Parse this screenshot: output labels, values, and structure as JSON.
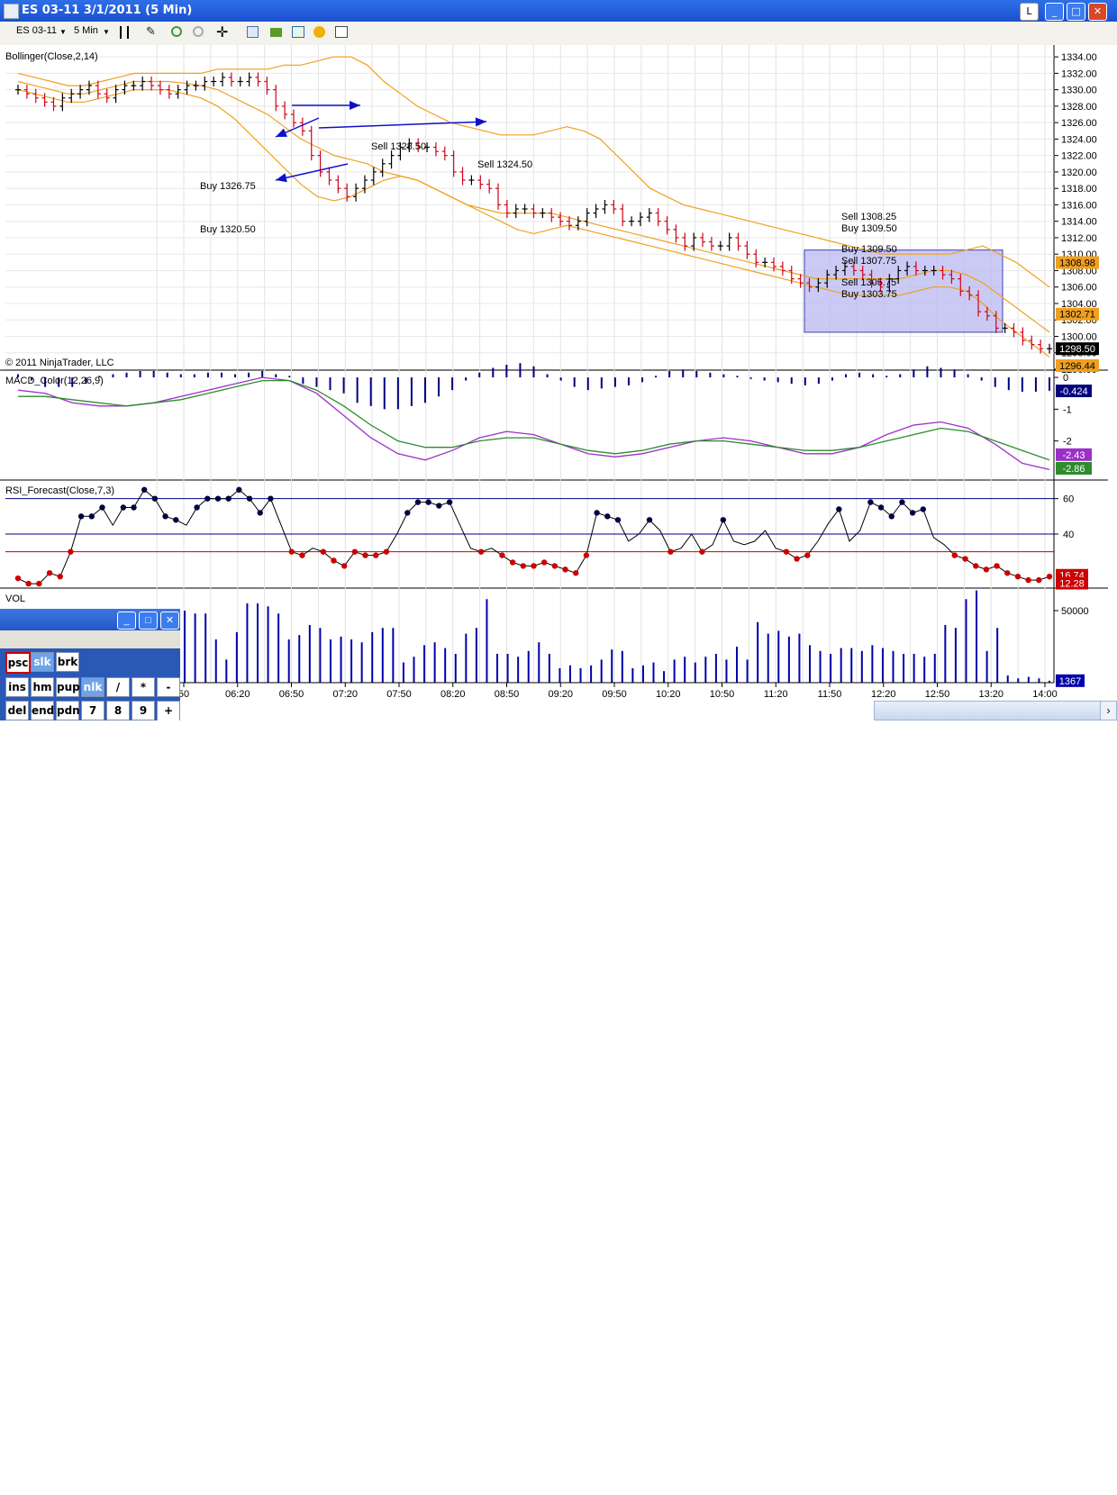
{
  "window": {
    "title": "ES 03-11  3/1/2011 (5 Min)",
    "buttons": {
      "lock": "L",
      "minimize": "_",
      "maximize": "□",
      "close": "✕"
    }
  },
  "toolbar": {
    "instrument": "ES 03-11",
    "interval": "5 Min",
    "icons": [
      "bar-style-icon",
      "drawing-tool-icon",
      "zoom-in-icon",
      "zoom-out-icon",
      "crosshair-icon",
      "data-box-icon",
      "instrument-icon",
      "strategy-icon",
      "order-icon",
      "properties-icon"
    ]
  },
  "colors": {
    "up_bar": "#000000",
    "down_bar": "#d0021b",
    "neutral_bar": "#2ea02e",
    "bollinger": "#f0a020",
    "macd_hist": "#000080",
    "macd_line": "#9b30c8",
    "macd_signal": "#2e8b2e",
    "rsi_line": "#000000",
    "rsi_high_dot": "#000040",
    "rsi_low_dot": "#cc0000",
    "volume": "#0000aa",
    "highlight_box": "#b8b8f0"
  },
  "chart_data": [
    {
      "type": "line",
      "title": "Bollinger(Close,2,14)",
      "copyright": "© 2011 NinjaTrader, LLC",
      "ylim": [
        1296,
        1335
      ],
      "y_ticks": [
        1334,
        1332,
        1330,
        1328,
        1326,
        1324,
        1322,
        1320,
        1318,
        1316,
        1314,
        1312,
        1310,
        1308,
        1306,
        1304,
        1302,
        1300,
        1298,
        1296
      ],
      "y_tick_labels": [
        "1334.00",
        "1332.00",
        "1330.00",
        "1328.00",
        "1326.00",
        "1324.00",
        "1322.00",
        "1320.00",
        "1318.00",
        "1316.00",
        "1314.00",
        "1312.00",
        "1310.00",
        "1308.00",
        "1306.00",
        "1304.00",
        "1302.00",
        "1300.00",
        "1298.00",
        "1296.00"
      ],
      "price_closes": [
        1330,
        1329.5,
        1329,
        1328.5,
        1328,
        1329,
        1329.5,
        1330,
        1330.5,
        1329.5,
        1329,
        1330,
        1330.5,
        1330.5,
        1331,
        1330.5,
        1330,
        1329.5,
        1330,
        1330.5,
        1330.5,
        1331,
        1331,
        1331.5,
        1331,
        1331,
        1331.5,
        1331,
        1330,
        1328,
        1327,
        1326,
        1325,
        1322,
        1320,
        1319,
        1318,
        1317,
        1318,
        1319,
        1320,
        1321,
        1322,
        1323,
        1323.5,
        1323,
        1323,
        1322.5,
        1322,
        1320,
        1319,
        1319,
        1318.5,
        1318,
        1316,
        1315,
        1315.5,
        1315.5,
        1315,
        1315,
        1314.5,
        1314,
        1313.5,
        1314,
        1315,
        1315.5,
        1316,
        1315.5,
        1314,
        1314,
        1314.5,
        1315,
        1314,
        1313,
        1312,
        1311,
        1312,
        1311.5,
        1311,
        1311,
        1312,
        1311,
        1310,
        1309,
        1309,
        1308.5,
        1308,
        1307,
        1306.5,
        1306,
        1306.5,
        1307.5,
        1308,
        1308.5,
        1308,
        1307.5,
        1306.5,
        1306,
        1307,
        1308,
        1308.5,
        1308,
        1308,
        1308,
        1307.5,
        1307,
        1305.5,
        1305,
        1303,
        1302.5,
        1301,
        1301,
        1300.5,
        1299.5,
        1299,
        1298.5,
        1298.5
      ],
      "bollinger_upper": [
        1332,
        1331.5,
        1331,
        1330.5,
        1330.5,
        1331,
        1331.5,
        1332,
        1332,
        1332,
        1332,
        1332,
        1332.5,
        1332.5,
        1332.5,
        1332.5,
        1333,
        1333,
        1333.5,
        1334,
        1334,
        1333,
        1331,
        1329.5,
        1328,
        1327,
        1326,
        1325.5,
        1325,
        1324.5,
        1324.5,
        1324.5,
        1325,
        1325.5,
        1325,
        1324,
        1322,
        1320,
        1318,
        1317,
        1316,
        1315.5,
        1315,
        1314.5,
        1314,
        1313.5,
        1313,
        1312.5,
        1312,
        1311.5,
        1311,
        1310.5,
        1310,
        1310,
        1310,
        1310,
        1310,
        1310.5,
        1311,
        1310,
        1309,
        1307.5,
        1306
      ],
      "bollinger_middle": [
        1331,
        1330.5,
        1330,
        1329.5,
        1329.5,
        1330,
        1330.5,
        1331,
        1331,
        1331,
        1330.8,
        1330.5,
        1330,
        1329,
        1328,
        1327,
        1325.5,
        1324,
        1323,
        1322,
        1321.5,
        1321,
        1320,
        1319.5,
        1319,
        1318,
        1317,
        1316,
        1315.5,
        1315,
        1315,
        1315,
        1315,
        1314.5,
        1314,
        1313.5,
        1313,
        1312.5,
        1312,
        1311.5,
        1311,
        1310.5,
        1310,
        1309.5,
        1309,
        1308.5,
        1308,
        1307.5,
        1307,
        1307,
        1307,
        1307,
        1307,
        1307,
        1307.5,
        1308,
        1308,
        1307.5,
        1306.5,
        1305,
        1303.5,
        1302,
        1300.5
      ],
      "bollinger_lower": [
        1330,
        1329.5,
        1329,
        1328.5,
        1328.5,
        1329,
        1329.5,
        1330,
        1330,
        1330,
        1329.5,
        1329,
        1328,
        1326.5,
        1324.5,
        1322.5,
        1320.5,
        1318.5,
        1317,
        1316.5,
        1317,
        1318,
        1319,
        1319.5,
        1319,
        1318,
        1317,
        1316,
        1315,
        1314,
        1313,
        1312.5,
        1313,
        1313.5,
        1313,
        1312.5,
        1312,
        1311.5,
        1311,
        1310.5,
        1310,
        1309.5,
        1309,
        1308.5,
        1308,
        1307.5,
        1307,
        1306.5,
        1306,
        1305.5,
        1305,
        1305,
        1305,
        1305,
        1305.5,
        1306,
        1306,
        1305.5,
        1304,
        1302,
        1300.5,
        1299,
        1297.5
      ],
      "annotations": [
        "Sell 1328.50",
        "Sell 1324.50",
        "Buy 1326.75",
        "Buy 1320.50",
        "Sell 1308.25",
        "Buy 1309.50",
        "Buy 1309.50",
        "Sell 1307.75",
        "Sell 1305.75",
        "Buy 1303.75"
      ],
      "price_markers": [
        {
          "label": "1308.98",
          "value": 1308.98,
          "color": "#f0a020"
        },
        {
          "label": "1302.71",
          "value": 1302.71,
          "color": "#f0a020"
        },
        {
          "label": "1298.50",
          "value": 1298.5,
          "color": "#000000"
        },
        {
          "label": "1296.44",
          "value": 1296.44,
          "color": "#f0a020"
        }
      ]
    },
    {
      "type": "bar",
      "title": "MACD_Color(12,26,9)",
      "ylim": [
        -3.2,
        0.2
      ],
      "y_ticks": [
        0,
        -1,
        -2
      ],
      "y_tick_labels": [
        "0",
        "-1",
        "-2"
      ],
      "histogram": [
        0.1,
        -0.1,
        -0.3,
        -0.3,
        -0.3,
        -0.2,
        0.05,
        0.1,
        0.15,
        0.2,
        0.2,
        0.15,
        0.1,
        0.1,
        0.15,
        0.15,
        0.1,
        0.15,
        0.2,
        0.1,
        0.05,
        -0.2,
        -0.3,
        -0.4,
        -0.5,
        -0.8,
        -0.9,
        -1.0,
        -1.0,
        -0.9,
        -0.8,
        -0.6,
        -0.4,
        -0.1,
        0.15,
        0.3,
        0.4,
        0.45,
        0.35,
        0.1,
        -0.1,
        -0.3,
        -0.4,
        -0.35,
        -0.3,
        -0.25,
        -0.15,
        0.05,
        0.2,
        0.25,
        0.2,
        0.15,
        0.1,
        0.05,
        -0.05,
        -0.1,
        -0.15,
        -0.2,
        -0.25,
        -0.2,
        -0.1,
        0.1,
        0.15,
        0.1,
        0.05,
        0.1,
        0.25,
        0.35,
        0.3,
        0.25,
        0.1,
        -0.1,
        -0.3,
        -0.4,
        -0.45,
        -0.45,
        -0.42
      ],
      "macd_line": [
        -0.4,
        -0.5,
        -0.8,
        -0.9,
        -0.9,
        -0.8,
        -0.6,
        -0.4,
        -0.2,
        0,
        -0.1,
        -0.5,
        -1.2,
        -1.9,
        -2.4,
        -2.6,
        -2.3,
        -1.9,
        -1.7,
        -1.8,
        -2.1,
        -2.4,
        -2.5,
        -2.4,
        -2.2,
        -2.0,
        -1.9,
        -2.0,
        -2.2,
        -2.4,
        -2.4,
        -2.2,
        -1.8,
        -1.5,
        -1.4,
        -1.6,
        -2.1,
        -2.7,
        -2.9
      ],
      "signal_line": [
        -0.6,
        -0.6,
        -0.7,
        -0.8,
        -0.9,
        -0.8,
        -0.7,
        -0.5,
        -0.3,
        -0.1,
        -0.1,
        -0.4,
        -0.9,
        -1.5,
        -2.0,
        -2.2,
        -2.2,
        -2.0,
        -1.9,
        -1.9,
        -2.1,
        -2.3,
        -2.4,
        -2.3,
        -2.1,
        -2.0,
        -2.0,
        -2.1,
        -2.2,
        -2.3,
        -2.3,
        -2.2,
        -2.0,
        -1.8,
        -1.6,
        -1.7,
        -2.0,
        -2.3,
        -2.6
      ],
      "markers": [
        {
          "label": "-0.424",
          "value": -0.424,
          "color": "#000080"
        },
        {
          "label": "-2.43",
          "value": -2.43,
          "color": "#9b30c8"
        },
        {
          "label": "-2.86",
          "value": -2.86,
          "color": "#2e8b2e"
        }
      ]
    },
    {
      "type": "line",
      "title": "RSI_Forecast(Close,7,3)",
      "ylim": [
        10,
        70
      ],
      "y_ticks": [
        60,
        40
      ],
      "y_tick_labels": [
        "60",
        "40"
      ],
      "levels": [
        60,
        40,
        30
      ],
      "values": [
        15,
        12,
        12,
        18,
        16,
        30,
        50,
        50,
        55,
        45,
        55,
        55,
        65,
        60,
        50,
        48,
        45,
        55,
        60,
        60,
        60,
        65,
        60,
        52,
        60,
        45,
        30,
        28,
        32,
        30,
        25,
        22,
        30,
        28,
        28,
        30,
        40,
        52,
        58,
        58,
        56,
        58,
        45,
        32,
        30,
        32,
        28,
        24,
        22,
        22,
        24,
        22,
        20,
        18,
        28,
        52,
        50,
        48,
        36,
        40,
        48,
        42,
        30,
        32,
        40,
        30,
        34,
        48,
        36,
        34,
        36,
        42,
        32,
        30,
        26,
        28,
        36,
        46,
        54,
        36,
        42,
        58,
        55,
        50,
        58,
        52,
        54,
        38,
        34,
        28,
        26,
        22,
        20,
        22,
        18,
        16,
        14,
        14,
        16
      ],
      "markers": [
        {
          "label": "16.74",
          "value": 16.74,
          "color": "#cc0000"
        },
        {
          "label": "12.28",
          "value": 12.28,
          "color": "#cc0000"
        }
      ]
    },
    {
      "type": "bar",
      "title": "VOL",
      "ylim": [
        0,
        65000
      ],
      "y_ticks": [
        50000
      ],
      "y_tick_labels": [
        "50000"
      ],
      "values": [
        1000,
        500,
        1500,
        800,
        500,
        400,
        600,
        500,
        300,
        800,
        600,
        500,
        300,
        400,
        2000,
        4500,
        50000,
        48000,
        48000,
        30000,
        16000,
        35000,
        55000,
        55000,
        53000,
        48000,
        30000,
        33000,
        40000,
        38000,
        30000,
        32000,
        30000,
        28000,
        35000,
        38000,
        38000,
        14000,
        18000,
        26000,
        28000,
        24000,
        20000,
        34000,
        38000,
        58000,
        20000,
        20000,
        18000,
        22000,
        28000,
        20000,
        10000,
        12000,
        10000,
        12000,
        16000,
        23000,
        22000,
        10000,
        12000,
        14000,
        8000,
        16000,
        18000,
        14000,
        18000,
        20000,
        16000,
        25000,
        16000,
        42000,
        34000,
        36000,
        32000,
        34000,
        26000,
        22000,
        20000,
        24000,
        24000,
        22000,
        26000,
        24000,
        22000,
        20000,
        20000,
        18000,
        20000,
        40000,
        38000,
        58000,
        64000,
        22000,
        38000,
        5000,
        3000,
        4000,
        3000,
        1367
      ],
      "marker": {
        "label": "1367",
        "value": 1367,
        "color": "#0000aa"
      },
      "x_tick_labels": [
        "50",
        "06:20",
        "06:50",
        "07:20",
        "07:50",
        "08:20",
        "08:50",
        "09:20",
        "09:50",
        "10:20",
        "10:50",
        "11:20",
        "11:50",
        "12:20",
        "12:50",
        "13:20",
        "14:00"
      ]
    }
  ],
  "keyboard": {
    "title_buttons": {
      "minimize": "_",
      "maximize": "□",
      "close": "✕"
    },
    "row1": [
      "psc",
      "slk",
      "brk"
    ],
    "row2": [
      "ins",
      "hm",
      "pup",
      "nlk",
      "/",
      "*",
      "-"
    ],
    "row3": [
      "del",
      "end",
      "pdn",
      "7",
      "8",
      "9",
      "+"
    ]
  }
}
